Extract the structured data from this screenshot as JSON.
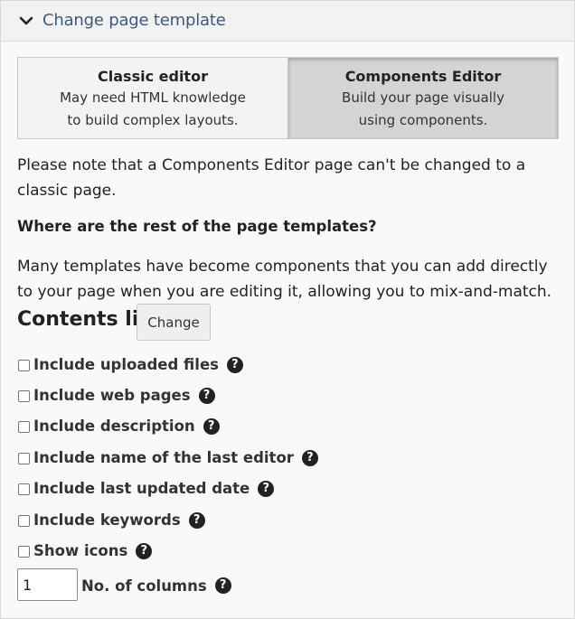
{
  "section": {
    "title": "Change page template",
    "icon": "chevron-down-icon"
  },
  "templates": [
    {
      "title": "Classic editor",
      "line1": "May need HTML knowledge",
      "line2": "to build complex layouts.",
      "selected": false
    },
    {
      "title": "Components Editor",
      "line1": "Build your page visually",
      "line2": "using components.",
      "selected": true
    }
  ],
  "note": "Please note that a Components Editor page can't be changed to a classic page.",
  "question": "Where are the rest of the page templates?",
  "explanation": "Many templates have become components that you can add directly to your page when you are editing it, allowing you to mix-and-match.",
  "contents_list": {
    "title": "Contents list",
    "change_label": "Change",
    "options": [
      {
        "label": "Include uploaded files",
        "checked": false
      },
      {
        "label": "Include web pages",
        "checked": false
      },
      {
        "label": "Include description",
        "checked": false
      },
      {
        "label": "Include name of the last editor",
        "checked": false
      },
      {
        "label": "Include last updated date",
        "checked": false
      },
      {
        "label": "Include keywords",
        "checked": false
      },
      {
        "label": "Show icons",
        "checked": false
      }
    ],
    "columns": {
      "value": "1",
      "label": "No. of columns"
    },
    "help_glyph": "?"
  }
}
